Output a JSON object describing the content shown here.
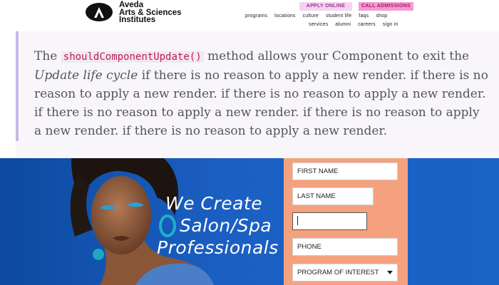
{
  "header": {
    "logo_lines": [
      "Aveda",
      "Arts & Sciences",
      "Institutes"
    ],
    "apply_label": "APPLY ONLINE",
    "call_label": "CALL ADMISSIONS",
    "nav_primary": [
      "programs",
      "locations",
      "culture",
      "student life",
      "faqs",
      "shop"
    ],
    "nav_secondary": [
      "services",
      "alumni",
      "careers",
      "sign in"
    ]
  },
  "doc": {
    "prefix": "The ",
    "code": "shouldComponentUpdate()",
    "after_code": " method allows your Component to exit the ",
    "emphasis": "Update life cycle",
    "body": " if there is no reason to apply a new render. if there is no reason to apply a new render. if there is no reason to apply a new render. if there is no reason to apply a new render. if there is no reason to apply a new render. if there is no reason to apply a new render."
  },
  "hero": {
    "title_lines": [
      "We Create",
      "Salon/Spa",
      "Professionals"
    ]
  },
  "form": {
    "first_name_placeholder": "FIRST NAME",
    "last_name_placeholder": "LAST NAME",
    "email_value": "",
    "phone_placeholder": "PHONE",
    "program_selected": "PROGRAM OF INTEREST"
  },
  "colors": {
    "hero_blue": "#1a5fc2",
    "form_orange": "#f6a17d",
    "apply_pill": "#f3d3f2",
    "call_pill": "#f39bd5",
    "code_pink": "#c2185b"
  }
}
